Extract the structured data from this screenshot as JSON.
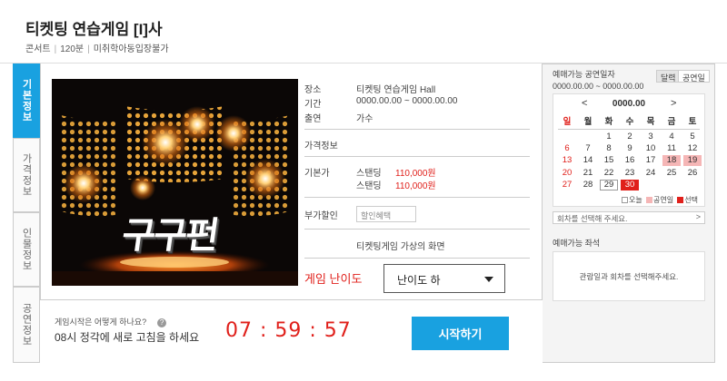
{
  "header": {
    "title": "티켓팅 연습게임 [I]사",
    "meta": [
      "콘서트",
      "120분",
      "미취학아동입장불가"
    ]
  },
  "tabs": [
    {
      "label": "기본정보",
      "active": true
    },
    {
      "label": "가격정보",
      "active": false
    },
    {
      "label": "인물정보",
      "active": false
    },
    {
      "label": "공연정보",
      "active": false
    }
  ],
  "poster": {
    "logo_text": "구구펀"
  },
  "info": {
    "venue_label": "장소",
    "venue": "티켓팅 연습게임 Hall",
    "period_label": "기간",
    "period": "0000.00.00 ~ 0000.00.00",
    "cast_label": "출연",
    "cast": "가수",
    "price_info_label": "가격정보",
    "base_price_label": "기본가",
    "prices": [
      {
        "seat": "스탠딩",
        "price": "110,000원"
      },
      {
        "seat": "스탠딩",
        "price": "110,000원"
      }
    ],
    "discount_label": "부가할인",
    "discount_placeholder": "할인혜택",
    "venue_screen": "티켓팅게임 가상의 화면",
    "difficulty_label": "게임 난이도",
    "difficulty_value": "난이도 하"
  },
  "bottom": {
    "howto": "게임시작은 어떻게 하나요?",
    "help_icon": "?",
    "reset_msg": "08시 정각에 새로 고침을 하세요",
    "timer": "07 : 59 : 57",
    "start_label": "시작하기"
  },
  "side": {
    "title": "예매가능 공연일자",
    "range": "0000.00.00 ~ 0000.00.00",
    "toggle_calendar": "달력",
    "toggle_performance_day": "공연일",
    "cal_month": "0000.00",
    "prev": "<",
    "next": ">",
    "weekdays": [
      "일",
      "월",
      "화",
      "수",
      "목",
      "금",
      "토"
    ],
    "weeks": [
      [
        "",
        "",
        "1",
        "2",
        "3",
        "4",
        "5"
      ],
      [
        "6",
        "7",
        "8",
        "9",
        "10",
        "11",
        "12"
      ],
      [
        "13",
        "14",
        "15",
        "16",
        "17",
        "18",
        "19"
      ],
      [
        "20",
        "21",
        "22",
        "23",
        "24",
        "25",
        "26"
      ],
      [
        "27",
        "28",
        "29",
        "30",
        "",
        "",
        ""
      ]
    ],
    "holidays": [
      "18",
      "19"
    ],
    "selected": "30",
    "today": "29",
    "legend": {
      "today": "오늘",
      "holiday": "공연일",
      "selected": "선택"
    },
    "session_placeholder": "회차를 선택해 주세요.",
    "session_arrow": ">",
    "seats_title": "예매가능 좌석",
    "seats_msg": "관람일과 회차를 선택해주세요.",
    "colors": {
      "accent": "#19a1e0",
      "red": "#e0201b",
      "holiday": "#f5b6b6"
    }
  }
}
